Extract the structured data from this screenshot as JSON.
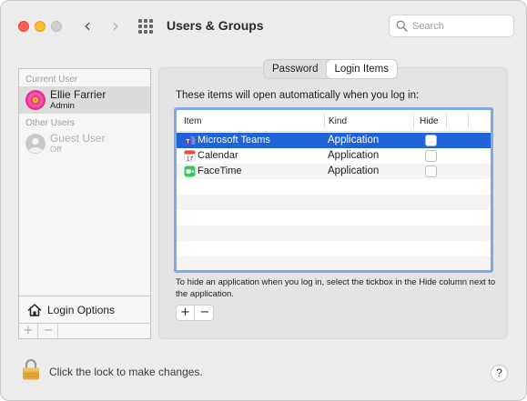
{
  "window": {
    "title": "Users & Groups",
    "search_placeholder": "Search"
  },
  "sidebar": {
    "current_user_label": "Current User",
    "current_user": {
      "name": "Ellie Farrier",
      "role": "Admin"
    },
    "other_users_label": "Other Users",
    "other_users": [
      {
        "name": "Guest User",
        "role": "Off"
      }
    ],
    "login_options_label": "Login Options",
    "add_label": "+",
    "remove_label": "−"
  },
  "tabs": [
    {
      "label": "Password",
      "active": false
    },
    {
      "label": "Login Items",
      "active": true
    }
  ],
  "login_items": {
    "intro": "These items will open automatically when you log in:",
    "columns": {
      "item": "Item",
      "kind": "Kind",
      "hide": "Hide"
    },
    "rows": [
      {
        "name": "Microsoft Teams",
        "kind": "Application",
        "hide": false,
        "icon": "teams-icon",
        "selected": true
      },
      {
        "name": "Calendar",
        "kind": "Application",
        "hide": false,
        "icon": "calendar-icon",
        "selected": false
      },
      {
        "name": "FaceTime",
        "kind": "Application",
        "hide": false,
        "icon": "facetime-icon",
        "selected": false
      }
    ],
    "help_text": "To hide an application when you log in, select the tickbox in the Hide column next to the application.",
    "add_label": "+",
    "remove_label": "−"
  },
  "footer": {
    "lock_text": "Click the lock to make changes.",
    "help_label": "?"
  },
  "colors": {
    "selection": "#1f63d6",
    "table_focus": "#7fa8e6",
    "close": "#ff5f57",
    "minimize": "#febc2e"
  }
}
